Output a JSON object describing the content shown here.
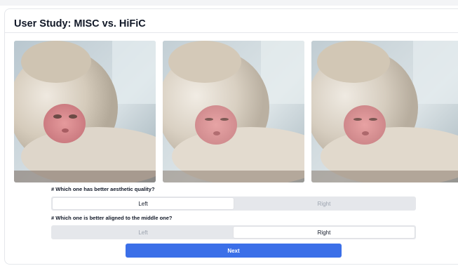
{
  "page": {
    "title": "User Study: MISC vs. HiFiC"
  },
  "images": {
    "left": {
      "name": "reconstruction-left"
    },
    "middle": {
      "name": "original-middle"
    },
    "right": {
      "name": "reconstruction-right"
    }
  },
  "questions": [
    {
      "text": "# Which one has better aesthetic quality?",
      "options": [
        "Left",
        "Right"
      ],
      "selected": "Left"
    },
    {
      "text": "# Which one is better aligned to the middle one?",
      "options": [
        "Left",
        "Right"
      ],
      "selected": "Right"
    }
  ],
  "actions": {
    "next_label": "Next"
  },
  "colors": {
    "accent": "#3b6fe8",
    "segment_bg": "#e5e7eb",
    "selected_bg": "#ffffff",
    "muted_text": "#9ca3af"
  }
}
